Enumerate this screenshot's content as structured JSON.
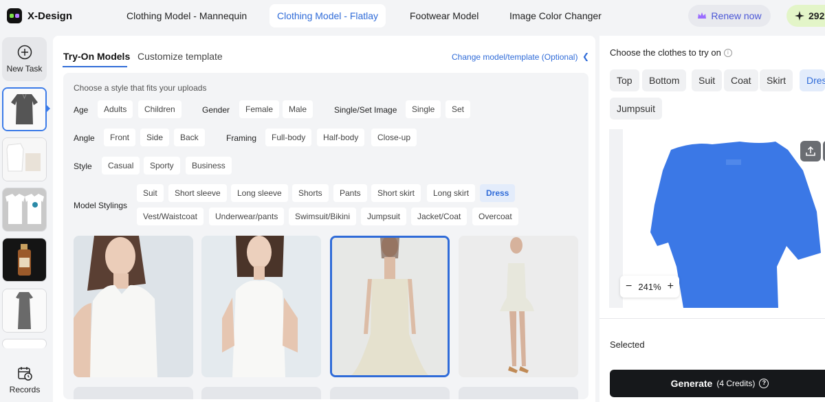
{
  "app": {
    "name": "X-Design"
  },
  "nav": {
    "tabs": [
      {
        "label": "Clothing Model - Mannequin"
      },
      {
        "label": "Clothing Model - Flatlay"
      },
      {
        "label": "Footwear Model"
      },
      {
        "label": "Image Color Changer"
      }
    ],
    "renew_label": "Renew now",
    "credits": "292"
  },
  "sidebar": {
    "new_task_label": "New Task",
    "records_label": "Records"
  },
  "middle": {
    "tabs": [
      {
        "label": "Try-On Models"
      },
      {
        "label": "Customize template"
      }
    ],
    "change_link": "Change model/template (Optional)",
    "hint": "Choose a style that fits your uploads",
    "age": {
      "label": "Age",
      "options": [
        "Adults",
        "Children"
      ]
    },
    "gender": {
      "label": "Gender",
      "options": [
        "Female",
        "Male"
      ]
    },
    "single_set": {
      "label": "Single/Set Image",
      "options": [
        "Single",
        "Set"
      ]
    },
    "angle": {
      "label": "Angle",
      "options": [
        "Front",
        "Side",
        "Back"
      ]
    },
    "framing": {
      "label": "Framing",
      "options": [
        "Full-body",
        "Half-body",
        "Close-up"
      ]
    },
    "style": {
      "label": "Style",
      "options": [
        "Casual",
        "Sporty",
        "Business"
      ]
    },
    "model_stylings": {
      "label": "Model Stylings",
      "row1": [
        "Suit",
        "Short sleeve",
        "Long sleeve",
        "Shorts",
        "Pants",
        "Short skirt",
        "Long skirt",
        "Dress"
      ],
      "row2": [
        "Vest/Waistcoat",
        "Underwear/pants",
        "Swimsuit/Bikini",
        "Jumpsuit",
        "Jacket/Coat",
        "Overcoat"
      ],
      "selected": "Dress"
    }
  },
  "right": {
    "title": "Choose the clothes to try on",
    "categories": [
      "Top",
      "Bottom",
      "Suit",
      "Coat",
      "Skirt",
      "Dress",
      "Jumpsuit"
    ],
    "selected_category": "Dress",
    "zoom": "241%",
    "selected_label": "Selected",
    "generate_label": "Generate",
    "generate_credits": "(4 Credits)"
  },
  "colors": {
    "accent": "#2f6bd8",
    "garment_mask": "#3b78e6",
    "generate_bg": "#16181b"
  }
}
